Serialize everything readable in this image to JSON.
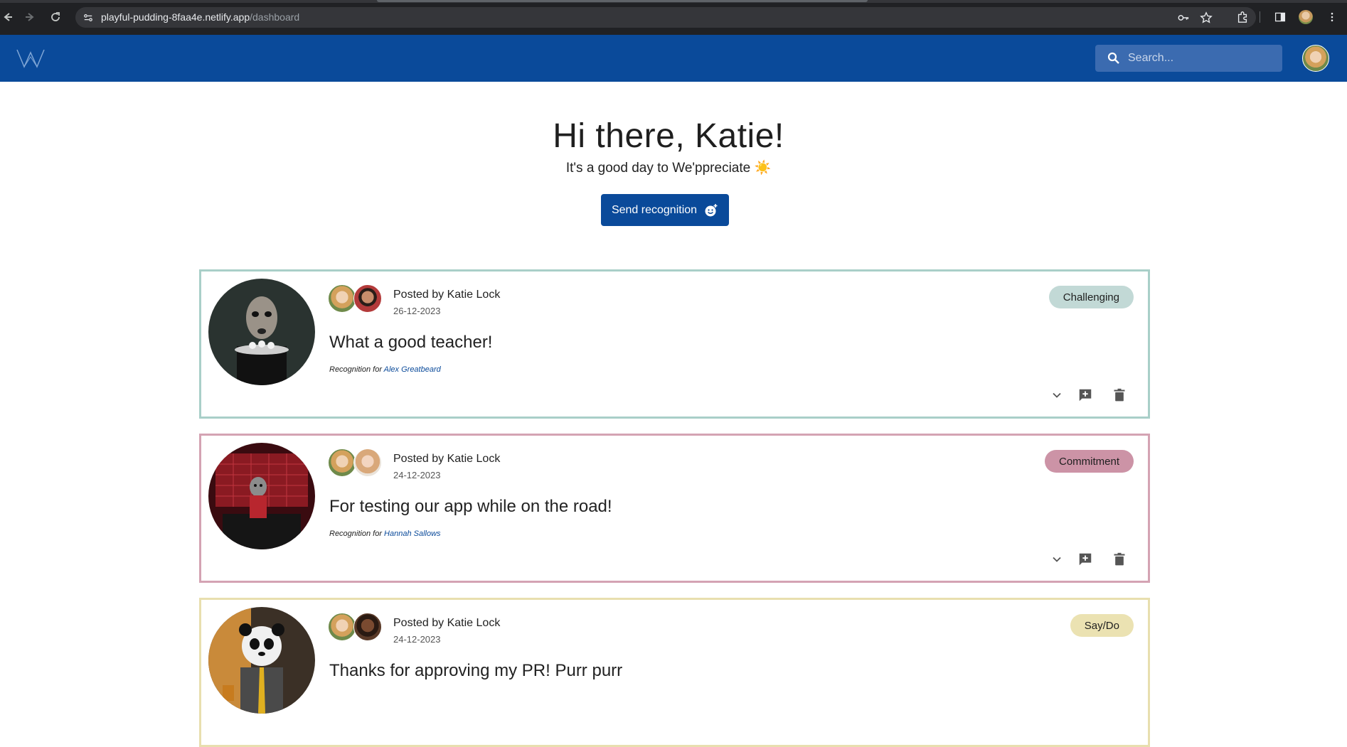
{
  "browser": {
    "url_host": "playful-pudding-8faa4e.netlify.app",
    "url_path": "/dashboard"
  },
  "header": {
    "search_placeholder": "Search..."
  },
  "hero": {
    "title": "Hi there, Katie!",
    "subtitle": "It's a good day to We'ppreciate ☀️",
    "send_button": "Send recognition"
  },
  "posts": [
    {
      "posted_by": "Posted by Katie Lock",
      "date": "26-12-2023",
      "message": "What a good teacher!",
      "recognition_prefix": "Recognition for ",
      "recipient": "Alex Greatbeard",
      "tag": "Challenging",
      "tag_color": "#c2d9d6",
      "border_color": "#a9cfc8"
    },
    {
      "posted_by": "Posted by Katie Lock",
      "date": "24-12-2023",
      "message": "For testing our app while on the road!",
      "recognition_prefix": "Recognition for ",
      "recipient": "Hannah Sallows",
      "tag": "Commitment",
      "tag_color": "#cc93a6",
      "border_color": "#d4a3b3"
    },
    {
      "posted_by": "Posted by Katie Lock",
      "date": "24-12-2023",
      "message": "Thanks for approving my PR! Purr purr",
      "recognition_prefix": "",
      "recipient": "",
      "tag": "Say/Do",
      "tag_color": "#ebe2b2",
      "border_color": "#e8dfaf"
    }
  ]
}
